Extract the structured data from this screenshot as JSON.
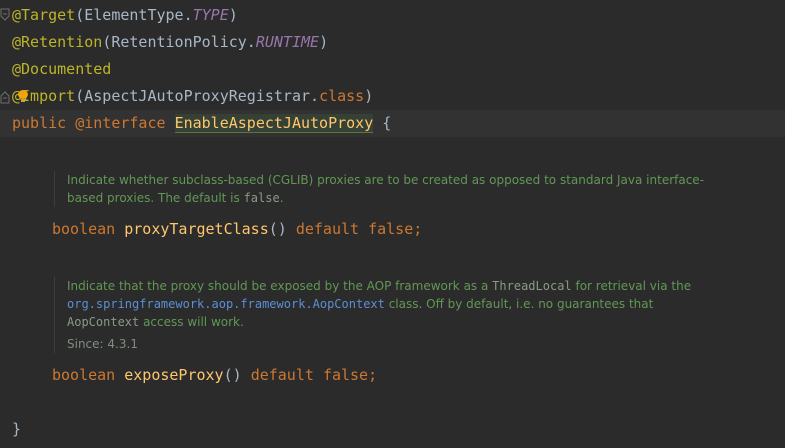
{
  "code": {
    "line1": {
      "annotation": "@Target",
      "open": "(ElementType.",
      "field": "TYPE",
      "close": ")"
    },
    "line2": {
      "annotation": "@Retention",
      "open": "(RetentionPolicy.",
      "field": "RUNTIME",
      "close": ")"
    },
    "line3": {
      "annotation": "@Documented"
    },
    "line4": {
      "annotation": "@Import",
      "open": "(AspectJAutoProxyRegistrar.",
      "keyword": "class",
      "close": ")"
    },
    "line5": {
      "kw_public": "public",
      "kw_interface": "@interface",
      "name": "EnableAspectJAutoProxy",
      "brace": "{"
    },
    "method1": {
      "type": "boolean",
      "name": "proxyTargetClass",
      "parens": "()",
      "kw_default": "default",
      "value": "false;"
    },
    "method2": {
      "type": "boolean",
      "name": "exposeProxy",
      "parens": "()",
      "kw_default": "default",
      "value": "false;"
    },
    "closing_brace": "}"
  },
  "doc1": {
    "text_a": "Indicate whether subclass-based (CGLIB) proxies are to be created as opposed to standard Java interface-based proxies. The default is ",
    "code_false": "false",
    "text_b": "."
  },
  "doc2": {
    "text_a": "Indicate that the proxy should be exposed by the AOP framework as a ",
    "code_threadlocal": "ThreadLocal",
    "text_b": " for retrieval via the ",
    "code_link": "org.springframework.aop.framework.AopContext",
    "text_c": " class. Off by default, i.e. no guarantees that ",
    "code_aopcontext": "AopContext",
    "text_d": " access will work.",
    "since_label": "Since:",
    "since_value": "4.3.1"
  },
  "colors": {
    "background": "#2b2b2b",
    "annotation": "#bbb529",
    "keyword": "#cc7832",
    "method": "#ffc66d",
    "doc_text": "#629755",
    "link": "#5c8fd4"
  },
  "icons": [
    "fold-marker-icon",
    "intention-bulb-icon"
  ]
}
